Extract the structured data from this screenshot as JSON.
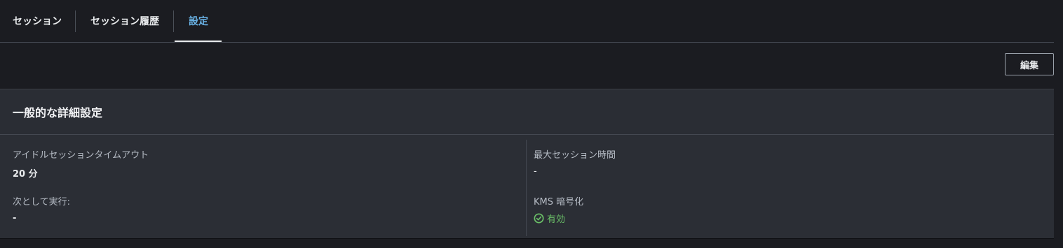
{
  "tabs": [
    {
      "label": "セッション"
    },
    {
      "label": "セッション履歴"
    },
    {
      "label": "設定"
    }
  ],
  "toolbar": {
    "edit_label": "編集"
  },
  "panel": {
    "title": "一般的な詳細設定",
    "left": [
      {
        "label": "アイドルセッションタイムアウト",
        "value": "20 分"
      },
      {
        "label": "次として実行:",
        "value": "-"
      }
    ],
    "right": [
      {
        "label": "最大セッション時間",
        "value": "-"
      },
      {
        "label": "KMS 暗号化",
        "value": "有効",
        "icon": "check-circle-icon"
      }
    ]
  },
  "colors": {
    "active_tab": "#6ab4e8",
    "success": "#6bc068"
  }
}
